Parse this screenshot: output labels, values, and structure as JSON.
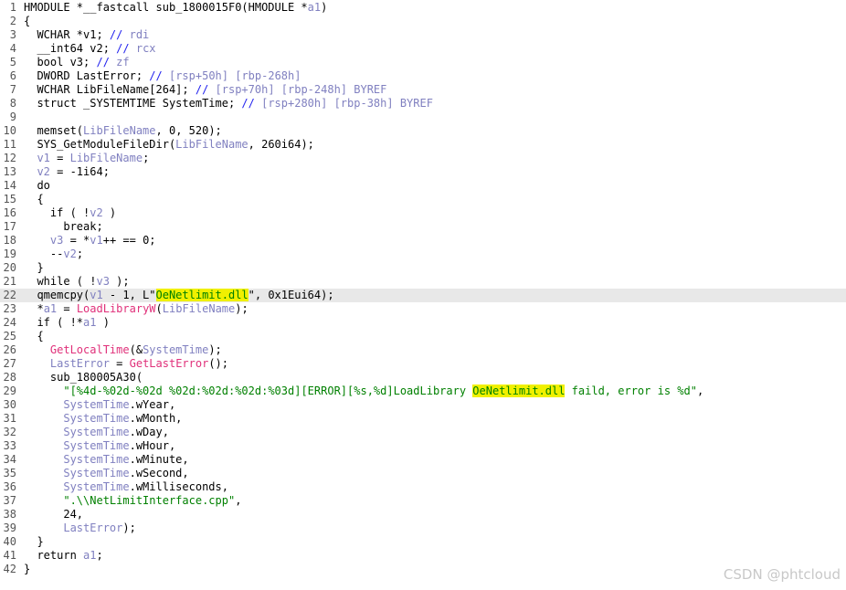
{
  "code_lines": [
    {
      "n": "1",
      "segs": [
        [
          "t",
          "HMODULE *__fastcall sub_1800015F0(HMODULE *"
        ],
        [
          "v",
          "a1"
        ],
        [
          "t",
          ")"
        ]
      ]
    },
    {
      "n": "2",
      "segs": [
        [
          "t",
          "{"
        ]
      ]
    },
    {
      "n": "3",
      "segs": [
        [
          "t",
          "  WCHAR *v1; "
        ],
        [
          "c",
          "// "
        ],
        [
          "cv",
          "rdi"
        ]
      ]
    },
    {
      "n": "4",
      "segs": [
        [
          "t",
          "  __int64 v2; "
        ],
        [
          "c",
          "// "
        ],
        [
          "cv",
          "rcx"
        ]
      ]
    },
    {
      "n": "5",
      "segs": [
        [
          "t",
          "  bool v3; "
        ],
        [
          "c",
          "// "
        ],
        [
          "cv",
          "zf"
        ]
      ]
    },
    {
      "n": "6",
      "segs": [
        [
          "t",
          "  DWORD LastError; "
        ],
        [
          "c",
          "// "
        ],
        [
          "cv",
          "[rsp+50h] [rbp-268h]"
        ]
      ]
    },
    {
      "n": "7",
      "segs": [
        [
          "t",
          "  WCHAR LibFileName[264]; "
        ],
        [
          "c",
          "// "
        ],
        [
          "cv",
          "[rsp+70h] [rbp-248h] BYREF"
        ]
      ]
    },
    {
      "n": "8",
      "segs": [
        [
          "t",
          "  struct _SYSTEMTIME SystemTime; "
        ],
        [
          "c",
          "// "
        ],
        [
          "cv",
          "[rsp+280h] [rbp-38h] BYREF"
        ]
      ]
    },
    {
      "n": "9",
      "segs": []
    },
    {
      "n": "10",
      "segs": [
        [
          "t",
          "  memset("
        ],
        [
          "v",
          "LibFileName"
        ],
        [
          "t",
          ", 0, 520);"
        ]
      ]
    },
    {
      "n": "11",
      "segs": [
        [
          "t",
          "  SYS_GetModuleFileDir("
        ],
        [
          "v",
          "LibFileName"
        ],
        [
          "t",
          ", 260i64);"
        ]
      ]
    },
    {
      "n": "12",
      "segs": [
        [
          "t",
          "  "
        ],
        [
          "v",
          "v1"
        ],
        [
          "t",
          " = "
        ],
        [
          "v",
          "LibFileName"
        ],
        [
          "t",
          ";"
        ]
      ]
    },
    {
      "n": "13",
      "segs": [
        [
          "t",
          "  "
        ],
        [
          "v",
          "v2"
        ],
        [
          "t",
          " = -1i64;"
        ]
      ]
    },
    {
      "n": "14",
      "segs": [
        [
          "t",
          "  do"
        ]
      ]
    },
    {
      "n": "15",
      "segs": [
        [
          "t",
          "  {"
        ]
      ]
    },
    {
      "n": "16",
      "segs": [
        [
          "t",
          "    if ( !"
        ],
        [
          "v",
          "v2"
        ],
        [
          "t",
          " )"
        ]
      ]
    },
    {
      "n": "17",
      "segs": [
        [
          "t",
          "      break;"
        ]
      ]
    },
    {
      "n": "18",
      "segs": [
        [
          "t",
          "    "
        ],
        [
          "v",
          "v3"
        ],
        [
          "t",
          " = *"
        ],
        [
          "v",
          "v1"
        ],
        [
          "t",
          "++ == 0;"
        ]
      ]
    },
    {
      "n": "19",
      "segs": [
        [
          "t",
          "    --"
        ],
        [
          "v",
          "v2"
        ],
        [
          "t",
          ";"
        ]
      ]
    },
    {
      "n": "20",
      "segs": [
        [
          "t",
          "  }"
        ]
      ]
    },
    {
      "n": "21",
      "segs": [
        [
          "t",
          "  while ( !"
        ],
        [
          "v",
          "v3"
        ],
        [
          "t",
          " );"
        ]
      ]
    },
    {
      "n": "22",
      "current": true,
      "segs": [
        [
          "t",
          "  qmemcpy("
        ],
        [
          "v",
          "v1"
        ],
        [
          "t",
          " - 1, L\""
        ],
        [
          "h",
          "OeNetlimit.dll"
        ],
        [
          "t",
          "\", 0x1Eui64);"
        ]
      ]
    },
    {
      "n": "23",
      "segs": [
        [
          "t",
          "  *"
        ],
        [
          "v",
          "a1"
        ],
        [
          "t",
          " = "
        ],
        [
          "f",
          "LoadLibraryW"
        ],
        [
          "t",
          "("
        ],
        [
          "v",
          "LibFileName"
        ],
        [
          "t",
          ");"
        ]
      ]
    },
    {
      "n": "24",
      "segs": [
        [
          "t",
          "  if ( !*"
        ],
        [
          "v",
          "a1"
        ],
        [
          "t",
          " )"
        ]
      ]
    },
    {
      "n": "25",
      "segs": [
        [
          "t",
          "  {"
        ]
      ]
    },
    {
      "n": "26",
      "segs": [
        [
          "t",
          "    "
        ],
        [
          "f",
          "GetLocalTime"
        ],
        [
          "t",
          "(&"
        ],
        [
          "v",
          "SystemTime"
        ],
        [
          "t",
          ");"
        ]
      ]
    },
    {
      "n": "27",
      "segs": [
        [
          "t",
          "    "
        ],
        [
          "v",
          "LastError"
        ],
        [
          "t",
          " = "
        ],
        [
          "f",
          "GetLastError"
        ],
        [
          "t",
          "();"
        ]
      ]
    },
    {
      "n": "28",
      "segs": [
        [
          "t",
          "    sub_180005A30("
        ]
      ]
    },
    {
      "n": "29",
      "segs": [
        [
          "t",
          "      "
        ],
        [
          "s",
          "\"[%4d-%02d-%02d %02d:%02d:%02d:%03d][ERROR][%s,%d]LoadLibrary "
        ],
        [
          "h",
          "OeNetlimit.dll"
        ],
        [
          "s",
          " faild, error is %d\""
        ],
        [
          "t",
          ","
        ]
      ]
    },
    {
      "n": "30",
      "segs": [
        [
          "t",
          "      "
        ],
        [
          "v",
          "SystemTime"
        ],
        [
          "t",
          ".wYear,"
        ]
      ]
    },
    {
      "n": "31",
      "segs": [
        [
          "t",
          "      "
        ],
        [
          "v",
          "SystemTime"
        ],
        [
          "t",
          ".wMonth,"
        ]
      ]
    },
    {
      "n": "32",
      "segs": [
        [
          "t",
          "      "
        ],
        [
          "v",
          "SystemTime"
        ],
        [
          "t",
          ".wDay,"
        ]
      ]
    },
    {
      "n": "33",
      "segs": [
        [
          "t",
          "      "
        ],
        [
          "v",
          "SystemTime"
        ],
        [
          "t",
          ".wHour,"
        ]
      ]
    },
    {
      "n": "34",
      "segs": [
        [
          "t",
          "      "
        ],
        [
          "v",
          "SystemTime"
        ],
        [
          "t",
          ".wMinute,"
        ]
      ]
    },
    {
      "n": "35",
      "segs": [
        [
          "t",
          "      "
        ],
        [
          "v",
          "SystemTime"
        ],
        [
          "t",
          ".wSecond,"
        ]
      ]
    },
    {
      "n": "36",
      "segs": [
        [
          "t",
          "      "
        ],
        [
          "v",
          "SystemTime"
        ],
        [
          "t",
          ".wMilliseconds,"
        ]
      ]
    },
    {
      "n": "37",
      "segs": [
        [
          "t",
          "      "
        ],
        [
          "s",
          "\".\\\\NetLimitInterface.cpp\""
        ],
        [
          "t",
          ","
        ]
      ]
    },
    {
      "n": "38",
      "segs": [
        [
          "t",
          "      24,"
        ]
      ]
    },
    {
      "n": "39",
      "segs": [
        [
          "t",
          "      "
        ],
        [
          "v",
          "LastError"
        ],
        [
          "t",
          ");"
        ]
      ]
    },
    {
      "n": "40",
      "segs": [
        [
          "t",
          "  }"
        ]
      ]
    },
    {
      "n": "41",
      "segs": [
        [
          "t",
          "  return "
        ],
        [
          "v",
          "a1"
        ],
        [
          "t",
          ";"
        ]
      ]
    },
    {
      "n": "42",
      "segs": [
        [
          "t",
          "}"
        ]
      ]
    }
  ],
  "token_colors": {
    "plain": "#000000",
    "variable": "#8080c0",
    "comment": "#2222ee",
    "string": "#008000",
    "function": "#e0307a",
    "highlight": "#f0f000",
    "current_line": "#e8e8e8"
  },
  "watermark": "CSDN @phtcloud"
}
